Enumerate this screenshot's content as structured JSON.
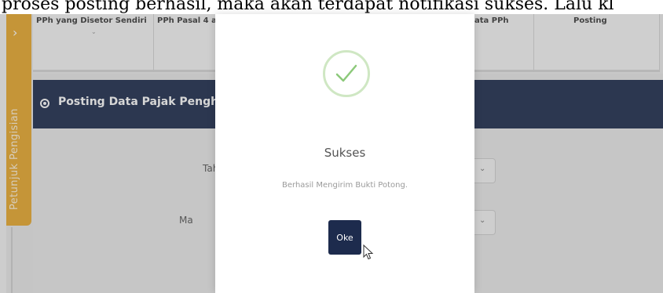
{
  "caption": {
    "text": "proses posting berhasil, maka akan terdapat notifikasi sukses. Lalu kl"
  },
  "sidebar": {
    "tab_label": "Petunjuk Pengisian",
    "arrow": "›"
  },
  "tabs": [
    {
      "label": "PPh yang Disetor Sendiri",
      "chevron": "⌄"
    },
    {
      "label": "PPh Pasal 4 a"
    },
    {
      "label": "ata PPh"
    },
    {
      "label": "Posting"
    }
  ],
  "panel": {
    "title": "Posting Data Pajak Penghasilan"
  },
  "form": {
    "label_1": "Tah",
    "label_2": "Ma",
    "select_chevron": "⌄"
  },
  "modal": {
    "title": "Sukses",
    "message": "Berhasil Mengirim Bukti Potong.",
    "ok_label": "Oke",
    "icon": "check-icon"
  },
  "colors": {
    "navy": "#1d2b4d",
    "sidebar_orange": "#e9a92c",
    "success_green": "#8cc97a"
  }
}
